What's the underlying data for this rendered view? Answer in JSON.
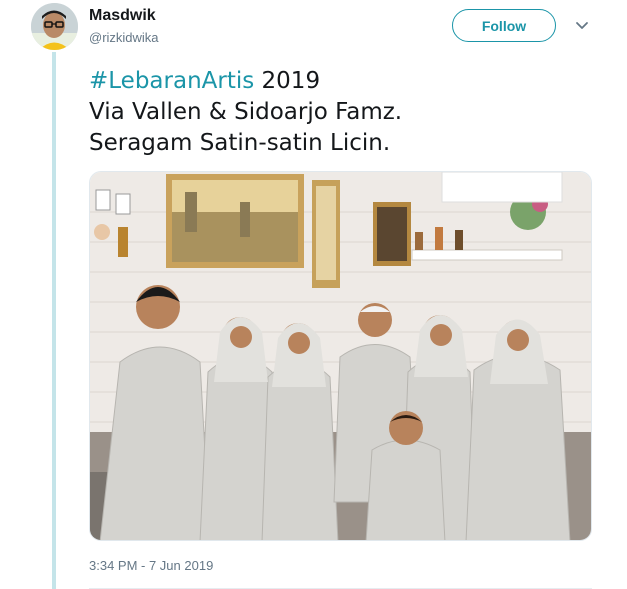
{
  "author": {
    "name": "Masdwik",
    "handle": "@rizkidwika"
  },
  "follow_button": {
    "label": "Follow"
  },
  "tweet": {
    "hashtag": "#LebaranArtis",
    "line1_rest": " 2019",
    "line2": "Via Vallen & Sidoarjo Famz.",
    "line3": "Seragam Satin-satin Licin."
  },
  "timestamp": "3:34 PM - 7 Jun 2019",
  "colors": {
    "accent": "#1b95a8",
    "thread_line": "#c4e4e9",
    "secondary_text": "#657786"
  },
  "icons": {
    "caret": "chevron-down-icon"
  }
}
